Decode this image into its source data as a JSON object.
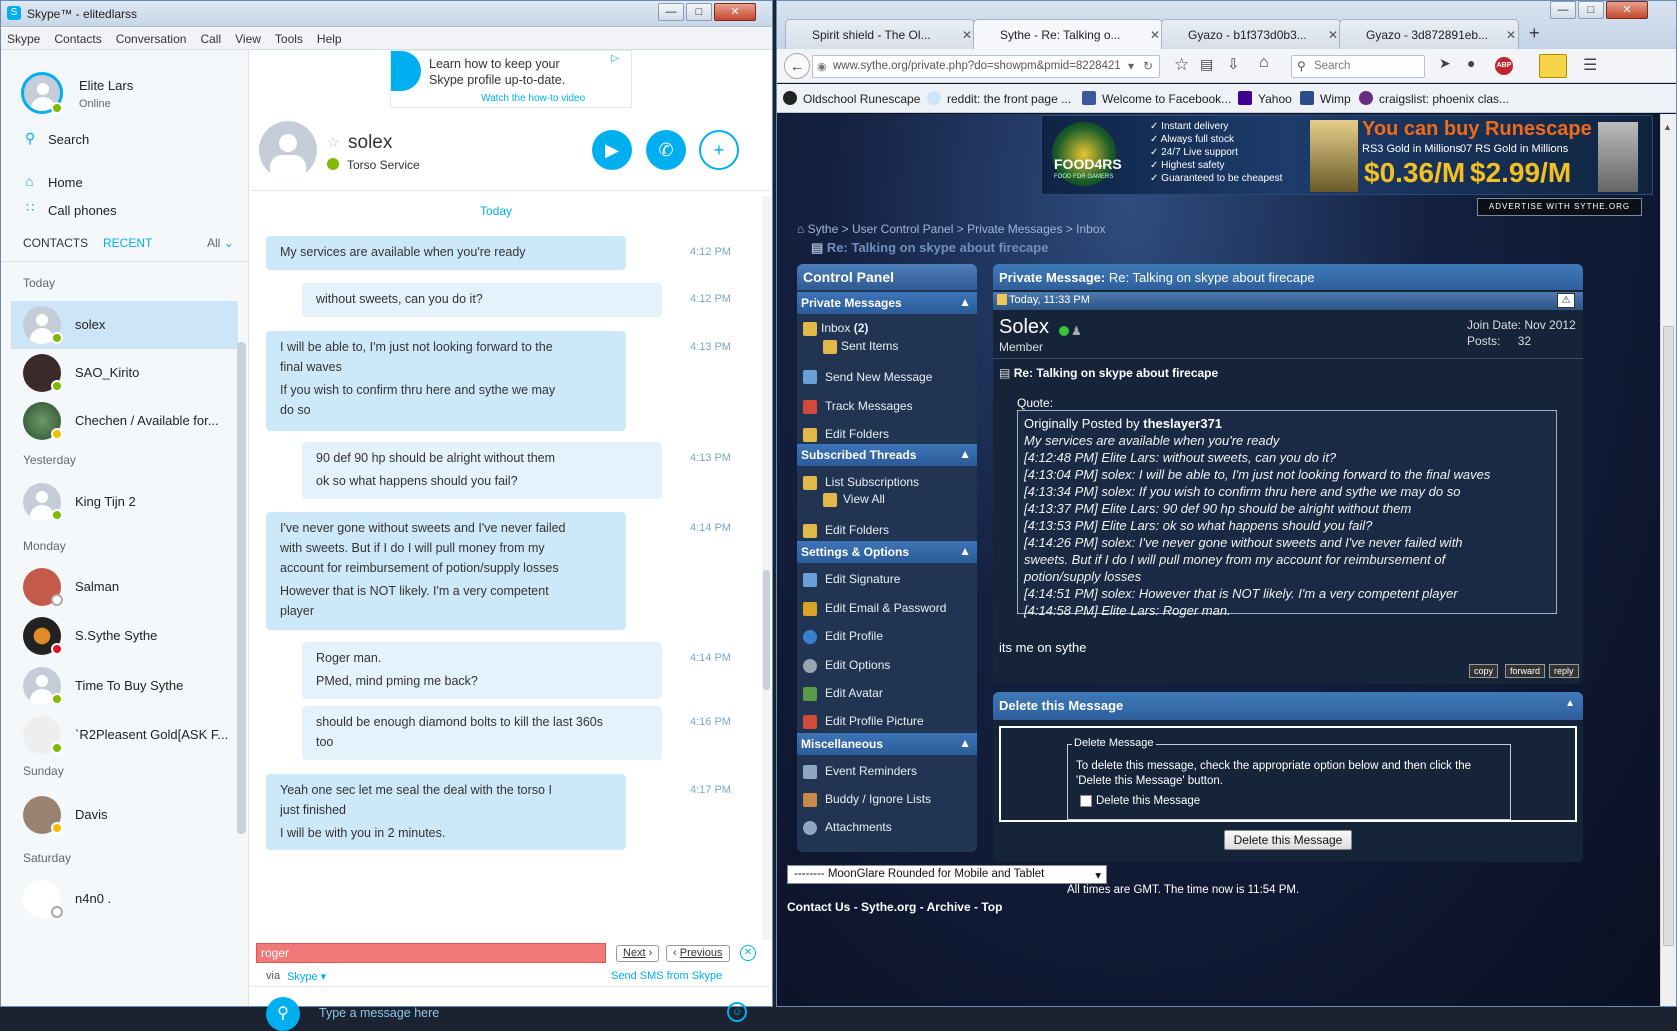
{
  "skype": {
    "title": "Skype™ - elitedlarss",
    "menu": [
      "Skype",
      "Contacts",
      "Conversation",
      "Call",
      "View",
      "Tools",
      "Help"
    ],
    "profile": {
      "name": "Elite Lars",
      "status": "Online"
    },
    "search_label": "Search",
    "nav": {
      "home": "Home",
      "call_phones": "Call phones"
    },
    "tabs": {
      "contacts": "CONTACTS",
      "recent": "RECENT",
      "filter": "All"
    },
    "sections": {
      "today": "Today",
      "yesterday": "Yesterday",
      "monday": "Monday",
      "sunday": "Sunday",
      "saturday": "Saturday"
    },
    "contacts": [
      {
        "name": "solex",
        "status": "online"
      },
      {
        "name": "SAO_Kirito",
        "status": "online"
      },
      {
        "name": "Chechen / Available for...",
        "status": "away"
      },
      {
        "name": "King Tijn 2",
        "status": "online"
      },
      {
        "name": "Salman",
        "status": "offline"
      },
      {
        "name": "S.Sythe Sythe",
        "status": "dnd"
      },
      {
        "name": "Time To Buy Sythe",
        "status": "online"
      },
      {
        "name": "`R2Pleasent Gold[ASK F...",
        "status": "online"
      },
      {
        "name": "Davis",
        "status": "away"
      },
      {
        "name": "n4n0 .",
        "status": "offline"
      }
    ],
    "ad": {
      "line1": "Learn how to keep your",
      "line2": "Skype profile up-to-date.",
      "link": "Watch the how-to video"
    },
    "chat": {
      "name": "solex",
      "mood": "Torso Service",
      "day_label": "Today",
      "messages": [
        {
          "text": "My services are available when you're ready",
          "time": "4:12 PM"
        },
        {
          "text": "without sweets, can you do it?",
          "time": "4:12 PM"
        },
        {
          "text": "I will be able to, I'm just not looking forward to the",
          "text2": "final waves",
          "text3": "If you wish to confirm thru here and sythe we may",
          "text4": "do so",
          "time": "4:13 PM"
        },
        {
          "text": "90 def 90 hp should be alright without them",
          "text2": "ok so what happens should you fail?",
          "time": "4:13 PM"
        },
        {
          "text": "I've never gone without sweets and I've never failed",
          "text2": "with sweets. But if I do I will pull money from my",
          "text3": "account for reimbursement of potion/supply losses",
          "text4": "However that is NOT likely. I'm a very competent",
          "text5": "player",
          "time": "4:14 PM"
        },
        {
          "text": "Roger man.",
          "text2": "PMed, mind pming me back?",
          "time": "4:14 PM"
        },
        {
          "text": "should be enough diamond bolts to kill the last 360s",
          "text2": "too",
          "time": "4:16 PM"
        },
        {
          "text": "Yeah one sec let me seal the deal with the torso I",
          "text2": "just finished",
          "text3": "I will be with you in 2 minutes.",
          "time": "4:17 PM"
        }
      ],
      "find_value": "roger",
      "next_label": "Next",
      "previous_label": "Previous",
      "via_label": "via",
      "via_value": "Skype",
      "sms_label": "Send SMS from Skype",
      "input_placeholder": "Type a message here"
    }
  },
  "firefox": {
    "tabs": [
      {
        "label": "Spirit shield - The Ol..."
      },
      {
        "label": "Sythe - Re: Talking o..."
      },
      {
        "label": "Gyazo - b1f373d0b3..."
      },
      {
        "label": "Gyazo - 3d872891eb..."
      }
    ],
    "url": "www.sythe.org/private.php?do=showpm&pmid=8228421",
    "search_placeholder": "Search",
    "bookmarks": [
      {
        "label": "Oldschool Runescape",
        "color": "#222222"
      },
      {
        "label": "reddit: the front page ...",
        "color": "#cee3f8"
      },
      {
        "label": "Welcome to Facebook...",
        "color": "#3b5998"
      },
      {
        "label": "Yahoo",
        "color": "#400090"
      },
      {
        "label": "Wimp",
        "color": "#2a4e8a"
      },
      {
        "label": "craigslist: phoenix clas...",
        "color": "#6b2d83"
      }
    ],
    "banner": {
      "brand": "FOOD4RS",
      "brand_sub": "FOOD FOR GAMERS",
      "features": [
        "Instant delivery",
        "Always full stock",
        "24/7 Live support",
        "Highest safety",
        "Guaranteed to be cheapest"
      ],
      "headline": "You can buy Runescape",
      "rs3_label": "RS3 Gold in Millions",
      "rs3_price": "$0.36/M",
      "rs07_label": "07 RS Gold in Millions",
      "rs07_price": "$2.99/M",
      "advertise": "ADVERTISE WITH SYTHE.ORG"
    },
    "breadcrumb": {
      "parts": [
        "Sythe",
        ">",
        "User Control Panel",
        ">",
        "Private Messages",
        ">",
        "Inbox"
      ],
      "title": "Re: Talking on skype about firecape"
    },
    "control_panel": {
      "title": "Control Panel",
      "private_messages": "Private Messages",
      "inbox": "Inbox",
      "inbox_count": "(2)",
      "sent_items": "Sent Items",
      "send_new": "Send New Message",
      "track": "Track Messages",
      "edit_folders": "Edit Folders",
      "subscribed_threads": "Subscribed Threads",
      "list_subscriptions": "List Subscriptions",
      "view_all": "View All",
      "edit_folders2": "Edit Folders",
      "settings_options": "Settings & Options",
      "edit_signature": "Edit Signature",
      "edit_email": "Edit Email & Password",
      "edit_profile": "Edit Profile",
      "edit_options": "Edit Options",
      "edit_avatar": "Edit Avatar",
      "edit_profile_picture": "Edit Profile Picture",
      "misc": "Miscellaneous",
      "event_reminders": "Event Reminders",
      "buddy_lists": "Buddy / Ignore Lists",
      "attachments": "Attachments"
    },
    "pm": {
      "header_label": "Private Message:",
      "header_title": "Re: Talking on skype about firecape",
      "date": "Today, 11:33 PM",
      "sender": "Solex",
      "sender_role": "Member",
      "join_label": "Join Date:",
      "join_value": "Nov 2012",
      "posts_label": "Posts:",
      "posts_value": "32",
      "subject": "Re: Talking on skype about firecape",
      "quote_label": "Quote:",
      "quote_prefix": "Originally Posted by",
      "quote_author": "theslayer371",
      "quote_lines": [
        "My services are available when you're ready",
        "[4:12:48 PM] Elite Lars: without sweets, can you do it?",
        "[4:13:04 PM] solex: I will be able to, I'm just not looking forward to the final waves",
        "[4:13:34 PM] solex: If you wish to confirm thru here and sythe we may do so",
        "[4:13:37 PM] Elite Lars: 90 def 90 hp should be alright without them",
        "[4:13:53 PM] Elite Lars: ok so what happens should you fail?",
        "[4:14:26 PM] solex: I've never gone without sweets and I've never failed with",
        "sweets. But if I do I will pull money from my account for reimbursement of",
        "potion/supply losses",
        "[4:14:51 PM] solex: However that is NOT likely. I'm a very competent player",
        "[4:14:58 PM] Elite Lars: Roger man."
      ],
      "body": "its me on sythe",
      "btn_copy": "copy",
      "btn_forward": "forward",
      "btn_reply": "reply"
    },
    "delete": {
      "title": "Delete this Message",
      "legend": "Delete Message",
      "text1": "To delete this message, check the appropriate option below and then click the",
      "text2": "'Delete this Message' button.",
      "checkbox_label": "Delete this Message",
      "button": "Delete this Message"
    },
    "footer": {
      "style_select": "-------- MoonGlare Rounded for Mobile and Tablet",
      "time_text": "All times are GMT. The time now is 11:54 PM.",
      "links": [
        "Contact Us",
        "-",
        "Sythe.org",
        "-",
        "Archive",
        "-",
        "Top"
      ]
    }
  }
}
